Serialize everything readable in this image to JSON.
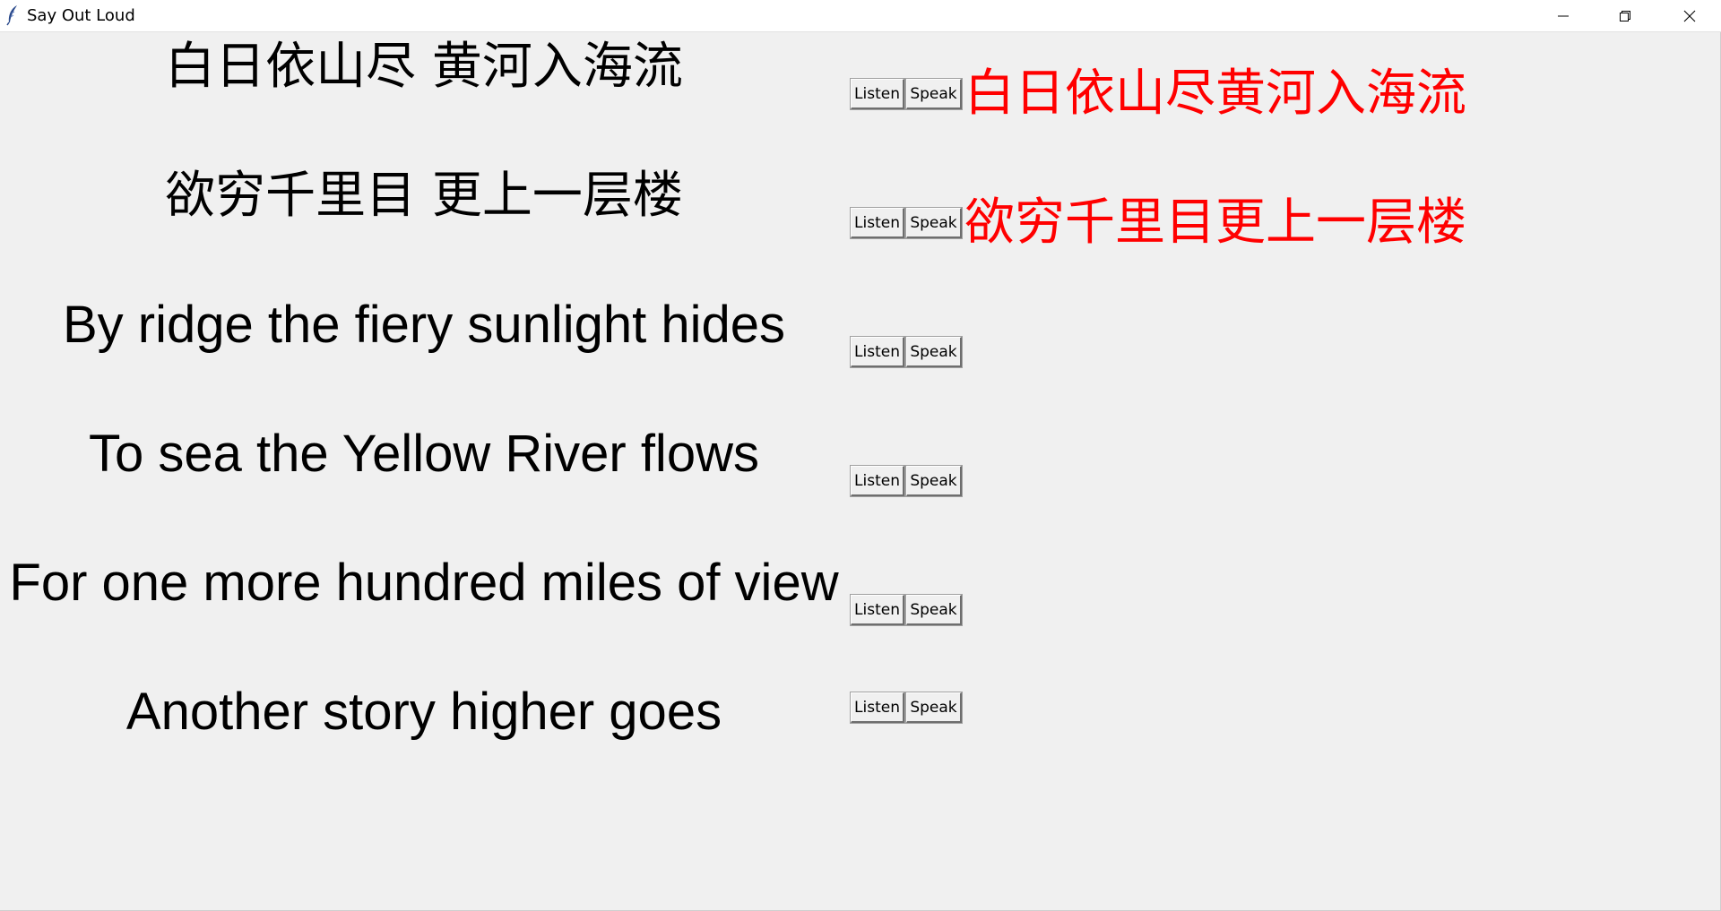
{
  "window": {
    "title": "Say Out Loud",
    "app_icon": "feather-icon",
    "controls": {
      "minimize_icon": "minimize-icon",
      "restore_icon": "restore-icon",
      "close_icon": "close-icon"
    }
  },
  "buttons": {
    "listen_label": "Listen",
    "speak_label": "Speak"
  },
  "colors": {
    "spoken_text": "#ff0000",
    "background": "#f0f0f0"
  },
  "rows": [
    {
      "text": "白日依山尽 黄河入海流",
      "spoken": "白日依山尽黄河入海流"
    },
    {
      "text": "欲穷千里目 更上一层楼",
      "spoken": "欲穷千里目更上一层楼"
    },
    {
      "text": "By ridge the fiery sunlight hides",
      "spoken": ""
    },
    {
      "text": "To sea the Yellow River flows",
      "spoken": ""
    },
    {
      "text": "For one more hundred miles of view",
      "spoken": ""
    },
    {
      "text": "Another story higher goes",
      "spoken": ""
    }
  ]
}
